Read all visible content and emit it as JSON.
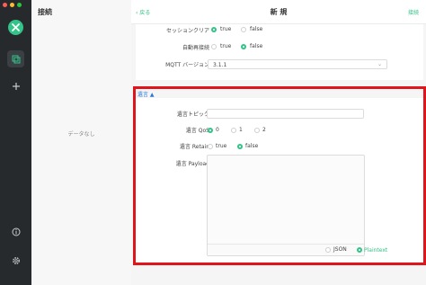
{
  "sidebar": {
    "traffic_colors": [
      "#ff5f57",
      "#febc2e",
      "#28c840"
    ],
    "icons": [
      "logo-icon",
      "connections-icon",
      "plus-icon",
      "info-icon",
      "settings-icon"
    ]
  },
  "connections": {
    "title": "接続",
    "empty_text": "データなし"
  },
  "header": {
    "back_label": "‹ 戻る",
    "title": "新 規",
    "connect_label": "接続"
  },
  "settings": {
    "clean_session": {
      "label": "セッションクリア",
      "options": [
        "true",
        "false"
      ],
      "selected": "true"
    },
    "auto_reconnect": {
      "label": "自動再接続",
      "options": [
        "true",
        "false"
      ],
      "selected": "false"
    },
    "mqtt_version": {
      "label": "MQTT バージョン",
      "value": "3.1.1"
    }
  },
  "will": {
    "section_label": "遺言 ▲",
    "topic": {
      "label": "遺言トピック",
      "value": ""
    },
    "qos": {
      "label": "遺言 QoS",
      "options": [
        "0",
        "1",
        "2"
      ],
      "selected": "0"
    },
    "retain": {
      "label": "遺言 Retain",
      "options": [
        "true",
        "false"
      ],
      "selected": "false"
    },
    "payload": {
      "label": "遺言 Payload",
      "value": "",
      "formats": [
        "JSON",
        "Plaintext"
      ],
      "selected_format": "Plaintext"
    }
  },
  "colors": {
    "accent": "#34c388",
    "highlight": "#e0141b",
    "link": "#2a78d6"
  }
}
